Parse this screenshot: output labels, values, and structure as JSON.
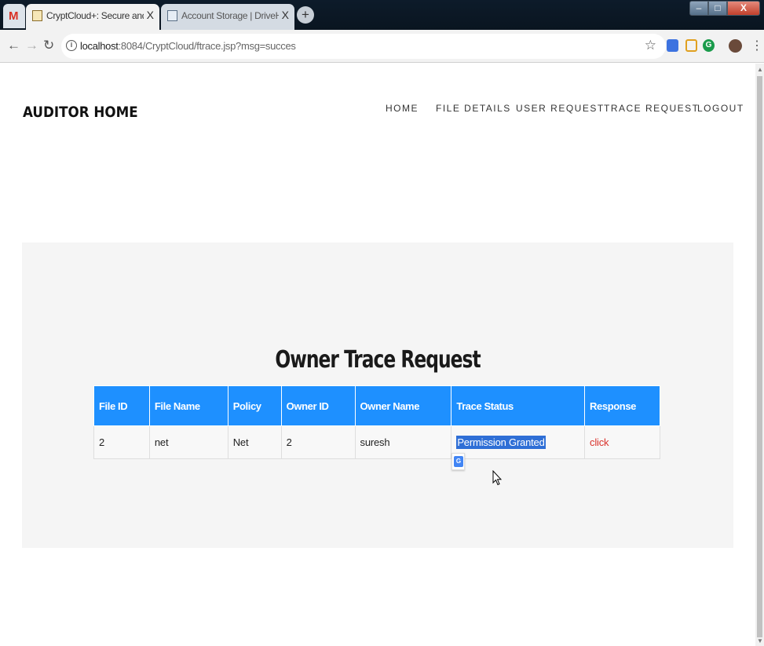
{
  "browser": {
    "tabs": [
      {
        "icon": "gmail-icon",
        "letter": "M"
      },
      {
        "title": "CryptCloud+: Secure and Expressive",
        "close": "X",
        "active": true
      },
      {
        "title": "Account Storage | DriveHQ",
        "close": "X",
        "active": false
      }
    ],
    "new_tab": "+",
    "window_buttons": {
      "minimize": "–",
      "maximize": "□",
      "close": "X"
    },
    "address": {
      "host": "localhost",
      "rest": ":8084/CryptCloud/ftrace.jsp?msg=succes"
    }
  },
  "page": {
    "brand": "AUDITOR HOME",
    "nav": [
      "HOME",
      "FILE DETAILS",
      "USER REQUEST",
      "TRACE REQUEST",
      "LOGOUT"
    ],
    "section_title": "Owner Trace Request",
    "table": {
      "headers": [
        "File ID",
        "File Name",
        "Policy",
        "Owner ID",
        "Owner Name",
        "Trace Status",
        "Response"
      ],
      "rows": [
        {
          "file_id": "2",
          "file_name": "net",
          "policy": "Net",
          "owner_id": "2",
          "owner_name": "suresh",
          "trace_status": "Permission Granted",
          "response": "click"
        }
      ]
    }
  },
  "colors": {
    "table_header": "#1e90ff",
    "link": "#d9322b",
    "panel_bg": "#f5f5f5"
  }
}
